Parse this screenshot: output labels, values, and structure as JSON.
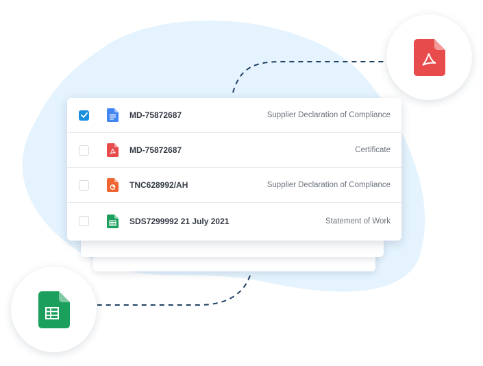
{
  "colors": {
    "blob": "#e4f3fd",
    "checked": "#1a8fdd",
    "pdf_red": "#e84b4b",
    "sheet_green": "#1aa05c",
    "doc_blue": "#4285f4",
    "slides_orange": "#f0652f",
    "dash_line": "#1f3f63"
  },
  "documents": [
    {
      "id": "MD-75872687",
      "type": "Supplier Declaration of Compliance",
      "checked": true,
      "icon": "google-doc-icon"
    },
    {
      "id": "MD-75872687",
      "type": "Certificate",
      "checked": false,
      "icon": "pdf-file-icon"
    },
    {
      "id": "TNC628992/AH",
      "type": "Supplier Declaration of Compliance",
      "checked": false,
      "icon": "slides-file-icon"
    },
    {
      "id": "SDS7299992 21 July 2021",
      "type": "Statement of Work",
      "checked": false,
      "icon": "sheet-file-icon"
    }
  ],
  "floating_icons": [
    "pdf-file-icon",
    "spreadsheet-file-icon"
  ]
}
